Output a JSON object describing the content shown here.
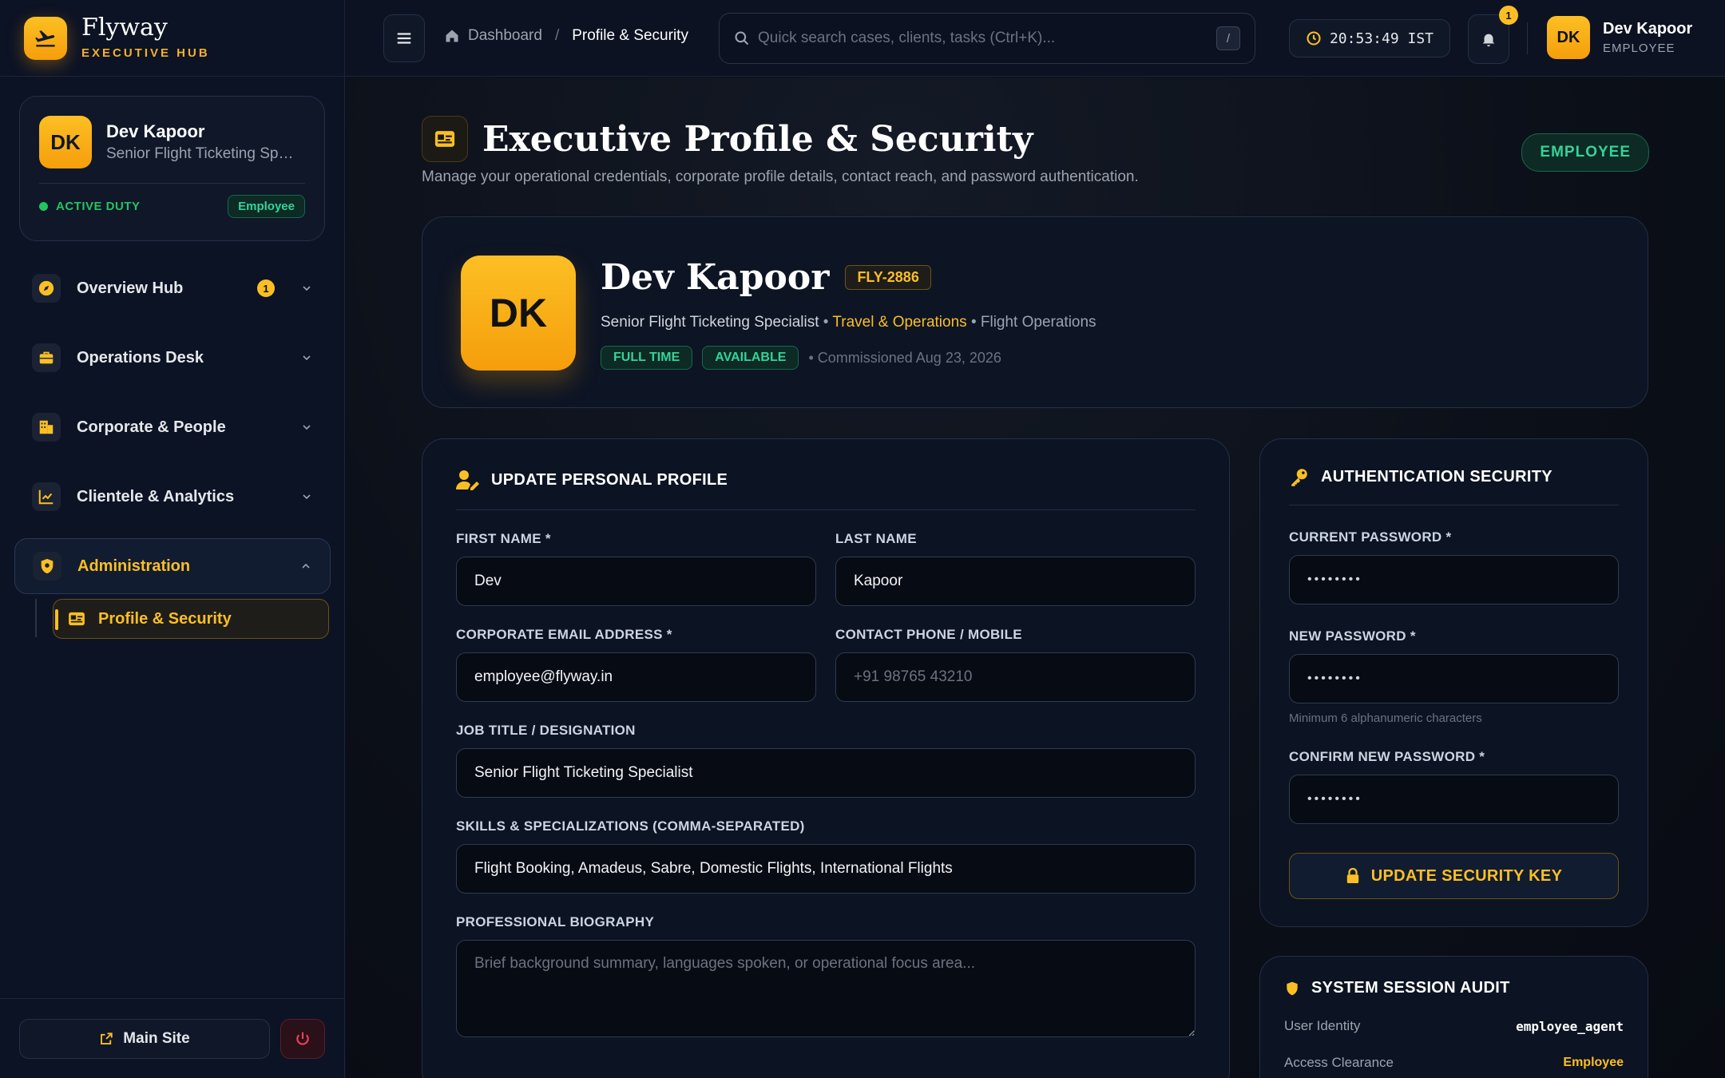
{
  "brand": {
    "name": "Flyway",
    "sub": "EXECUTIVE HUB"
  },
  "user_card": {
    "initials": "DK",
    "name": "Dev Kapoor",
    "role": "Senior Flight Ticketing Specialist",
    "status": "ACTIVE DUTY",
    "badge": "Employee"
  },
  "nav": {
    "items": [
      {
        "label": "Overview Hub",
        "icon": "compass-icon",
        "count": "1"
      },
      {
        "label": "Operations Desk",
        "icon": "briefcase-icon"
      },
      {
        "label": "Corporate & People",
        "icon": "building-icon"
      },
      {
        "label": "Clientele & Analytics",
        "icon": "chart-icon"
      },
      {
        "label": "Administration",
        "icon": "shield-icon"
      }
    ],
    "sub_item": "Profile & Security"
  },
  "footer": {
    "main_site": "Main Site"
  },
  "topbar": {
    "breadcrumb_home": "Dashboard",
    "breadcrumb_sep": "/",
    "breadcrumb_current": "Profile & Security",
    "search_placeholder": "Quick search cases, clients, tasks (Ctrl+K)...",
    "search_kbd": "/",
    "clock": "20:53:49 IST",
    "notifications": "1",
    "user_initials": "DK",
    "user_name": "Dev Kapoor",
    "user_role": "EMPLOYEE"
  },
  "page": {
    "title": "Executive Profile & Security",
    "subtitle": "Manage your operational credentials, corporate profile details, contact reach, and password authentication.",
    "badge": "EMPLOYEE"
  },
  "hero": {
    "initials": "DK",
    "name": "Dev Kapoor",
    "employee_id": "FLY-2886",
    "role": "Senior Flight Ticketing Specialist",
    "department": "Travel & Operations",
    "division": "Flight Operations",
    "tags": [
      "FULL TIME",
      "AVAILABLE"
    ],
    "commissioned": "• Commissioned Aug 23, 2026"
  },
  "profile_form": {
    "title": "UPDATE PERSONAL PROFILE",
    "first_name_label": "FIRST NAME *",
    "first_name": "Dev",
    "last_name_label": "LAST NAME",
    "last_name": "Kapoor",
    "email_label": "CORPORATE EMAIL ADDRESS *",
    "email": "employee@flyway.in",
    "phone_label": "CONTACT PHONE / MOBILE",
    "phone_placeholder": "+91 98765 43210",
    "job_label": "JOB TITLE / DESIGNATION",
    "job": "Senior Flight Ticketing Specialist",
    "skills_label": "SKILLS & SPECIALIZATIONS (COMMA-SEPARATED)",
    "skills": "Flight Booking, Amadeus, Sabre, Domestic Flights, International Flights",
    "bio_label": "PROFESSIONAL BIOGRAPHY",
    "bio_placeholder": "Brief background summary, languages spoken, or operational focus area..."
  },
  "security": {
    "title": "AUTHENTICATION SECURITY",
    "current_label": "CURRENT PASSWORD *",
    "current_mask": "••••••••",
    "new_label": "NEW PASSWORD *",
    "new_mask": "••••••••",
    "new_hint": "Minimum 6 alphanumeric characters",
    "confirm_label": "CONFIRM NEW PASSWORD *",
    "confirm_mask": "••••••••",
    "button": "UPDATE SECURITY KEY"
  },
  "audit": {
    "title": "SYSTEM SESSION AUDIT",
    "identity_label": "User Identity",
    "identity_value": "employee_agent",
    "clearance_label": "Access Clearance",
    "clearance_value": "Employee"
  },
  "colors": {
    "accent": "#fbbf24",
    "success": "#34d399",
    "background": "#0a0f1c"
  }
}
